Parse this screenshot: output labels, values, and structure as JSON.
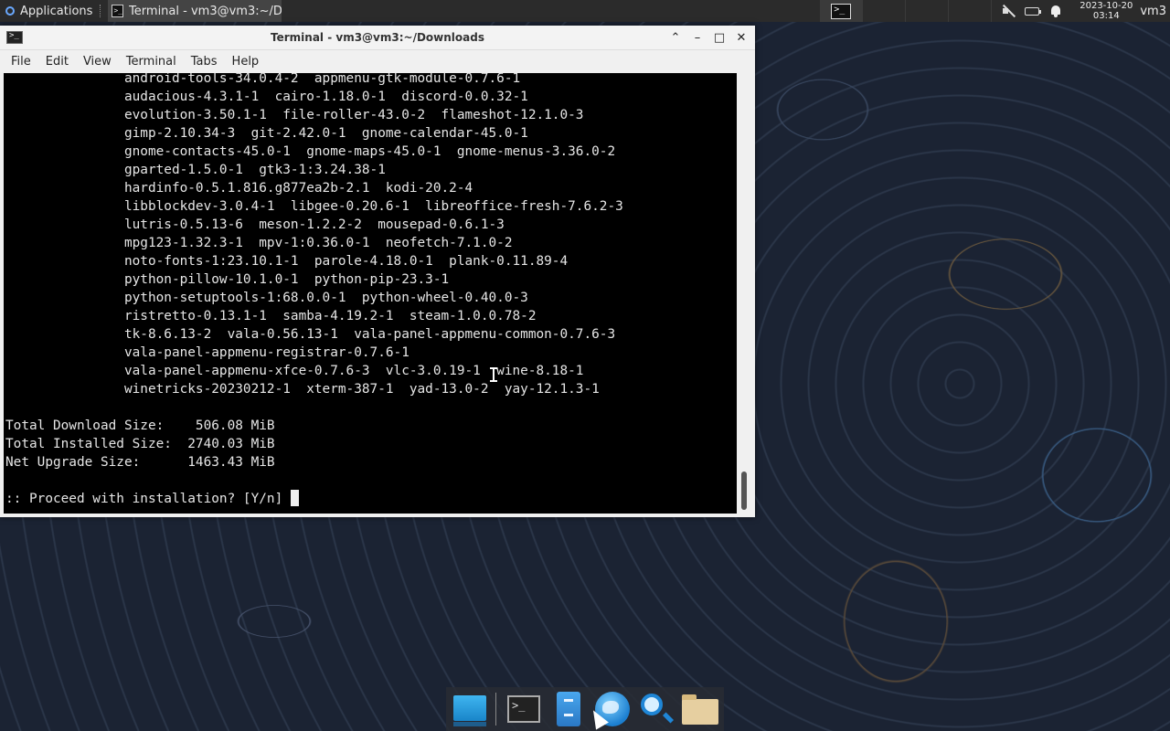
{
  "top_panel": {
    "applications_label": "Applications",
    "task_title": "Terminal - vm3@vm3:~/D...",
    "clock_date": "2023-10-20",
    "clock_time": "03:14",
    "user": "vm3"
  },
  "window": {
    "title": "Terminal - vm3@vm3:~/Downloads",
    "controls": {
      "up": "⌃",
      "minimize": "–",
      "maximize": "□",
      "close": "✕"
    },
    "menu": [
      "File",
      "Edit",
      "View",
      "Terminal",
      "Tabs",
      "Help"
    ]
  },
  "terminal": {
    "lines": [
      "               android-tools-34.0.4-2  appmenu-gtk-module-0.7.6-1",
      "               audacious-4.3.1-1  cairo-1.18.0-1  discord-0.0.32-1",
      "               evolution-3.50.1-1  file-roller-43.0-2  flameshot-12.1.0-3",
      "               gimp-2.10.34-3  git-2.42.0-1  gnome-calendar-45.0-1",
      "               gnome-contacts-45.0-1  gnome-maps-45.0-1  gnome-menus-3.36.0-2",
      "               gparted-1.5.0-1  gtk3-1:3.24.38-1",
      "               hardinfo-0.5.1.816.g877ea2b-2.1  kodi-20.2-4",
      "               libblockdev-3.0.4-1  libgee-0.20.6-1  libreoffice-fresh-7.6.2-3",
      "               lutris-0.5.13-6  meson-1.2.2-2  mousepad-0.6.1-3",
      "               mpg123-1.32.3-1  mpv-1:0.36.0-1  neofetch-7.1.0-2",
      "               noto-fonts-1:23.10.1-1  parole-4.18.0-1  plank-0.11.89-4",
      "               python-pillow-10.1.0-1  python-pip-23.3-1",
      "               python-setuptools-1:68.0.0-1  python-wheel-0.40.0-3",
      "               ristretto-0.13.1-1  samba-4.19.2-1  steam-1.0.0.78-2",
      "               tk-8.6.13-2  vala-0.56.13-1  vala-panel-appmenu-common-0.7.6-3",
      "               vala-panel-appmenu-registrar-0.7.6-1",
      "               vala-panel-appmenu-xfce-0.7.6-3  vlc-3.0.19-1  wine-8.18-1",
      "               winetricks-20230212-1  xterm-387-1  yad-13.0-2  yay-12.1.3-1",
      "",
      "Total Download Size:    506.08 MiB",
      "Total Installed Size:  2740.03 MiB",
      "Net Upgrade Size:      1463.43 MiB",
      "",
      ":: Proceed with installation? [Y/n] "
    ]
  },
  "dock": {
    "items": [
      "desktop-icon",
      "terminal-icon",
      "file-cabinet-icon",
      "web-browser-icon",
      "app-finder-icon",
      "file-manager-icon"
    ]
  }
}
